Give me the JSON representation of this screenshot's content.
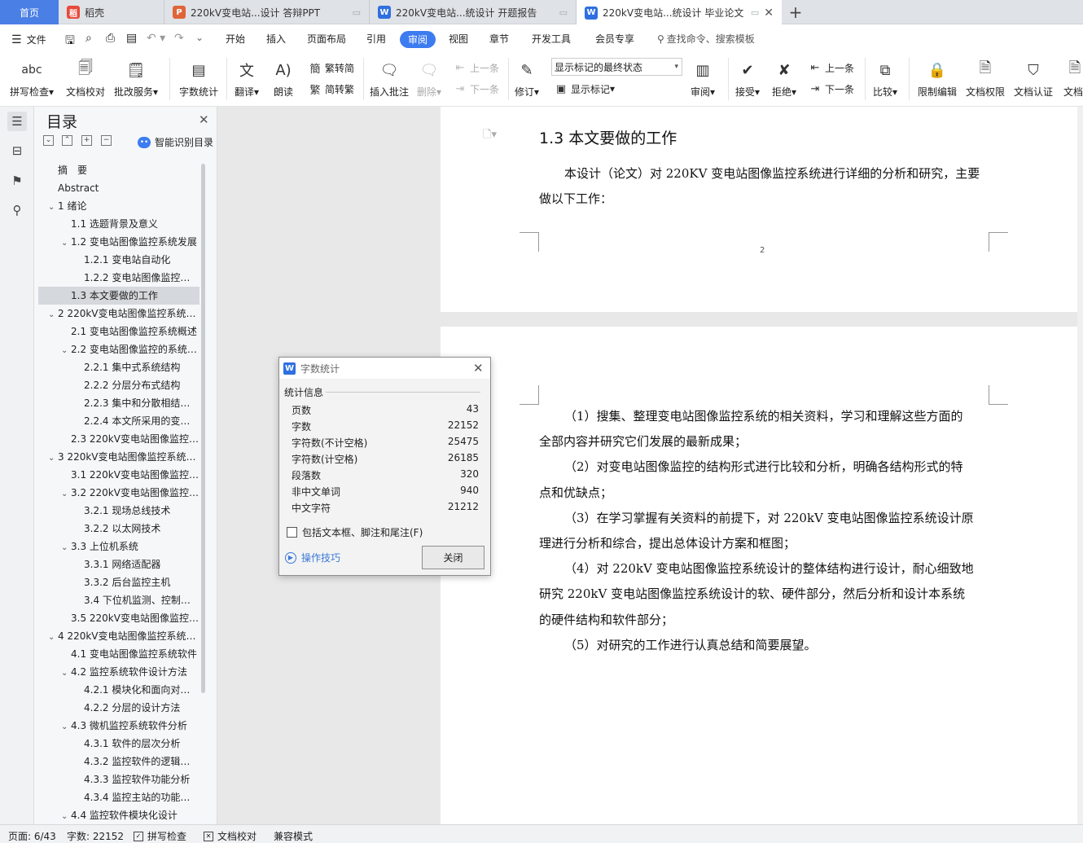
{
  "tabs": [
    {
      "label": "首页"
    },
    {
      "label": "稻壳"
    },
    {
      "label": "220kV变电站...设计 答辩PPT"
    },
    {
      "label": "220kV变电站...统设计 开题报告"
    },
    {
      "label": "220kV变电站...统设计 毕业论文"
    }
  ],
  "new_tab": "+",
  "menu": {
    "file": "文件",
    "items": [
      "开始",
      "插入",
      "页面布局",
      "引用",
      "审阅",
      "视图",
      "章节",
      "开发工具",
      "会员专享"
    ],
    "search_placeholder": "查找命令、搜索模板"
  },
  "ribbon": {
    "spellcheck": "拼写检查",
    "doccheck": "文档校对",
    "annotate_service": "批改服务",
    "wordcount": "字数统计",
    "translate": "翻译",
    "read_aloud": "朗读",
    "to_traditional": "繁转简",
    "to_simplified": "简转繁",
    "insert_comment": "插入批注",
    "delete": "删除",
    "prev_comment": "上一条",
    "next_comment": "下一条",
    "revise": "修订",
    "markup_state": "显示标记的最终状态",
    "show_markup": "显示标记",
    "review": "审阅",
    "accept": "接受",
    "reject": "拒绝",
    "prev_change": "上一条",
    "next_change": "下一条",
    "compare": "比较",
    "restrict_edit": "限制编辑",
    "doc_permission": "文档权限",
    "doc_cert": "文档认证",
    "doc_more": "文档"
  },
  "toc": {
    "title": "目录",
    "smart": "智能识别目录",
    "items": [
      {
        "text": "摘　要",
        "level": 0,
        "caret": false
      },
      {
        "text": "Abstract",
        "level": 0,
        "caret": false
      },
      {
        "text": "1  绪论",
        "level": 0,
        "caret": true
      },
      {
        "text": "1.1  选题背景及意义",
        "level": 1,
        "caret": false
      },
      {
        "text": "1.2  变电站图像监控系统发展",
        "level": 1,
        "caret": true
      },
      {
        "text": "1.2.1  变电站自动化",
        "level": 2,
        "caret": false
      },
      {
        "text": "1.2.2  变电站图像监控系统",
        "level": 2,
        "caret": false
      },
      {
        "text": "1.3  本文要做的工作",
        "level": 1,
        "caret": false,
        "selected": true
      },
      {
        "text": "2 220kV变电站图像监控系统结构",
        "level": 0,
        "caret": true
      },
      {
        "text": "2.1  变电站图像监控系统概述",
        "level": 1,
        "caret": false
      },
      {
        "text": "2.2  变电站图像监控的系统结构",
        "level": 1,
        "caret": true
      },
      {
        "text": "2.2.1  集中式系统结构",
        "level": 2,
        "caret": false
      },
      {
        "text": "2.2.2  分层分布式结构",
        "level": 2,
        "caret": false
      },
      {
        "text": "2.2.3  集中和分散相结合结构",
        "level": 2,
        "caret": false
      },
      {
        "text": "2.2.4  本文所采用的变电站结构",
        "level": 2,
        "caret": false
      },
      {
        "text": "2.3 220kV变电站图像监控系统",
        "level": 1,
        "caret": false
      },
      {
        "text": "3 220kV变电站图像监控系统硬件",
        "level": 0,
        "caret": true
      },
      {
        "text": "3.1 220kV变电站图像监控系统",
        "level": 1,
        "caret": false
      },
      {
        "text": "3.2 220kV变电站图像监控系统",
        "level": 1,
        "caret": true
      },
      {
        "text": "3.2.1  现场总线技术",
        "level": 2,
        "caret": false
      },
      {
        "text": "3.2.2  以太网技术",
        "level": 2,
        "caret": false
      },
      {
        "text": "3.3  上位机系统",
        "level": 1,
        "caret": true
      },
      {
        "text": "3.3.1  网络适配器",
        "level": 2,
        "caret": false
      },
      {
        "text": "3.3.2  后台监控主机",
        "level": 2,
        "caret": false
      },
      {
        "text": "3.4  下位机监测、控制单元",
        "level": 2,
        "caret": false
      },
      {
        "text": "3.5 220kV变电站图像监控系统",
        "level": 1,
        "caret": false
      },
      {
        "text": "4 220kV变电站图像监控系统软件",
        "level": 0,
        "caret": true
      },
      {
        "text": "4.1  变电站图像监控系统软件",
        "level": 1,
        "caret": false
      },
      {
        "text": "4.2  监控系统软件设计方法",
        "level": 1,
        "caret": true
      },
      {
        "text": "4.2.1  模块化和面向对象方法",
        "level": 2,
        "caret": false
      },
      {
        "text": "4.2.2  分层的设计方法",
        "level": 2,
        "caret": false
      },
      {
        "text": "4.3  微机监控系统软件分析",
        "level": 1,
        "caret": true
      },
      {
        "text": "4.3.1  软件的层次分析",
        "level": 2,
        "caret": false
      },
      {
        "text": "4.3.2  监控软件的逻辑结构",
        "level": 2,
        "caret": false
      },
      {
        "text": "4.3.3  监控软件功能分析",
        "level": 2,
        "caret": false
      },
      {
        "text": "4.3.4  监控主站的功能分析",
        "level": 2,
        "caret": false
      },
      {
        "text": "4.4  监控软件模块化设计",
        "level": 1,
        "caret": true
      }
    ]
  },
  "document": {
    "heading": "1.3  本文要做的工作",
    "intro_1": "本设计（论文）对 220KV 变电站图像监控系统进行详细的分析和研究，主要",
    "intro_2": "做以下工作：",
    "page_number": "2",
    "paragraphs": [
      "（1）搜集、整理变电站图像监控系统的相关资料，学习和理解这些方面的",
      "全部内容并研究它们发展的最新成果；",
      "（2）对变电站图像监控的结构形式进行比较和分析，明确各结构形式的特",
      "点和优缺点；",
      "（3）在学习掌握有关资料的前提下，对 220kV 变电站图像监控系统设计原",
      "理进行分析和综合，提出总体设计方案和框图；",
      "（4）对 220kV 变电站图像监控系统设计的整体结构进行设计，耐心细致地",
      "研究 220kV 变电站图像监控系统设计的软、硬件部分，然后分析和设计本系统",
      "的硬件结构和软件部分；",
      "（5）对研究的工作进行认真总结和简要展望。"
    ]
  },
  "dialog": {
    "title": "字数统计",
    "group": "统计信息",
    "stats": [
      {
        "label": "页数",
        "value": "43"
      },
      {
        "label": "字数",
        "value": "22152"
      },
      {
        "label": "字符数(不计空格)",
        "value": "25475"
      },
      {
        "label": "字符数(计空格)",
        "value": "26185"
      },
      {
        "label": "段落数",
        "value": "320"
      },
      {
        "label": "非中文单词",
        "value": "940"
      },
      {
        "label": "中文字符",
        "value": "21212"
      }
    ],
    "checkbox_label": "包括文本框、脚注和尾注(F)",
    "tips": "操作技巧",
    "close": "关闭"
  },
  "status": {
    "page": "页面: 6/43",
    "words": "字数: 22152",
    "spell": "拼写检查",
    "proof": "文档校对",
    "compat": "兼容模式"
  }
}
